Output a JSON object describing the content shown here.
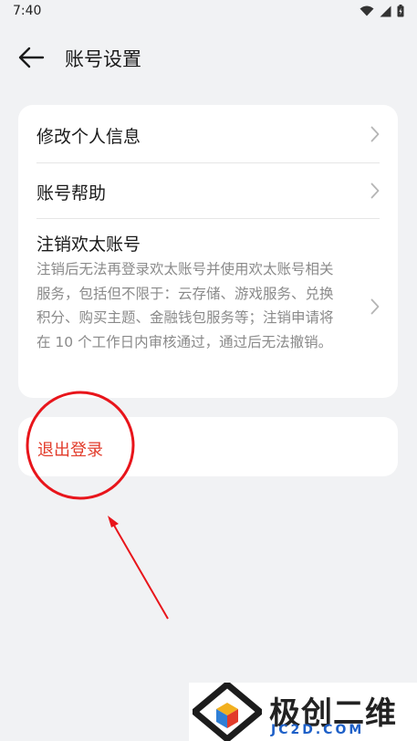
{
  "status_bar": {
    "time": "7:40",
    "icons": [
      "wifi-icon",
      "signal-icon",
      "battery-icon"
    ]
  },
  "header": {
    "title": "账号设置",
    "back_icon": "back-arrow-icon"
  },
  "settings": {
    "items": [
      {
        "label": "修改个人信息"
      },
      {
        "label": "账号帮助"
      },
      {
        "label": "注销欢太账号",
        "description": "注销后无法再登录欢太账号并使用欢太账号相关服务，包括但不限于：云存储、游戏服务、兑换积分、购买主题、金融钱包服务等；注销申请将在 10 个工作日内审核通过，通过后无法撤销。"
      }
    ]
  },
  "logout": {
    "label": "退出登录"
  },
  "annotation": {
    "color": "#e8151b"
  },
  "watermark": {
    "text": "极创二维",
    "sub": "JC2D.COM"
  },
  "colors": {
    "background": "#f1f2f4",
    "card": "#ffffff",
    "danger_text": "#e23b2a",
    "secondary_text": "#8a8a8a"
  }
}
